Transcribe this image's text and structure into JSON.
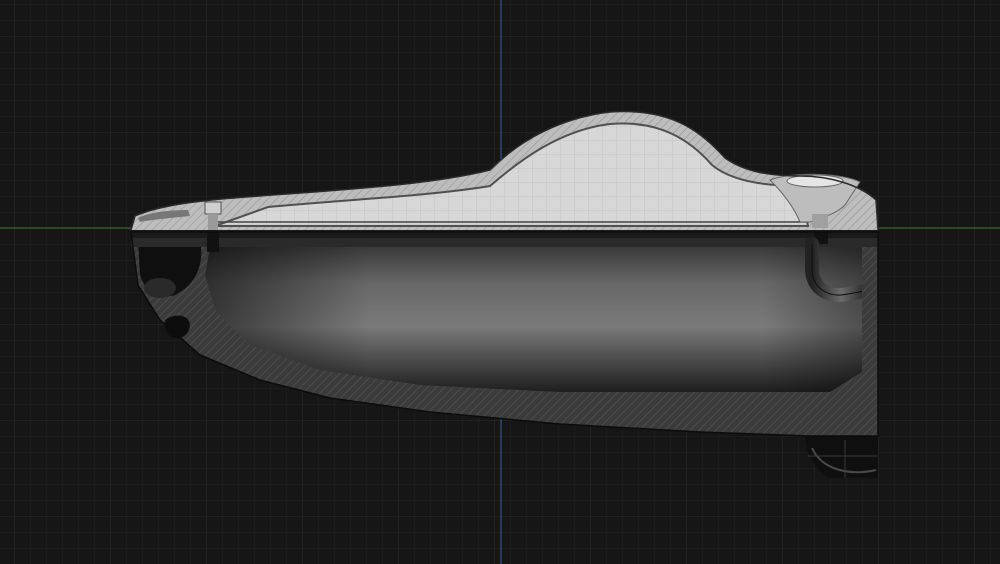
{
  "viewport": {
    "background": "#161616",
    "grid_minor_color": "#232323",
    "grid_major_color": "#2d2d2d",
    "axis_x_color": "#3f7a3f",
    "axis_y_color": "#3e5c9a"
  },
  "model": {
    "section_fill": "#3a3a3a",
    "canopy_fill": "#d9d9d9",
    "hull_dark": "#1c1c1c",
    "hatch_color": "#5a5a5a"
  }
}
